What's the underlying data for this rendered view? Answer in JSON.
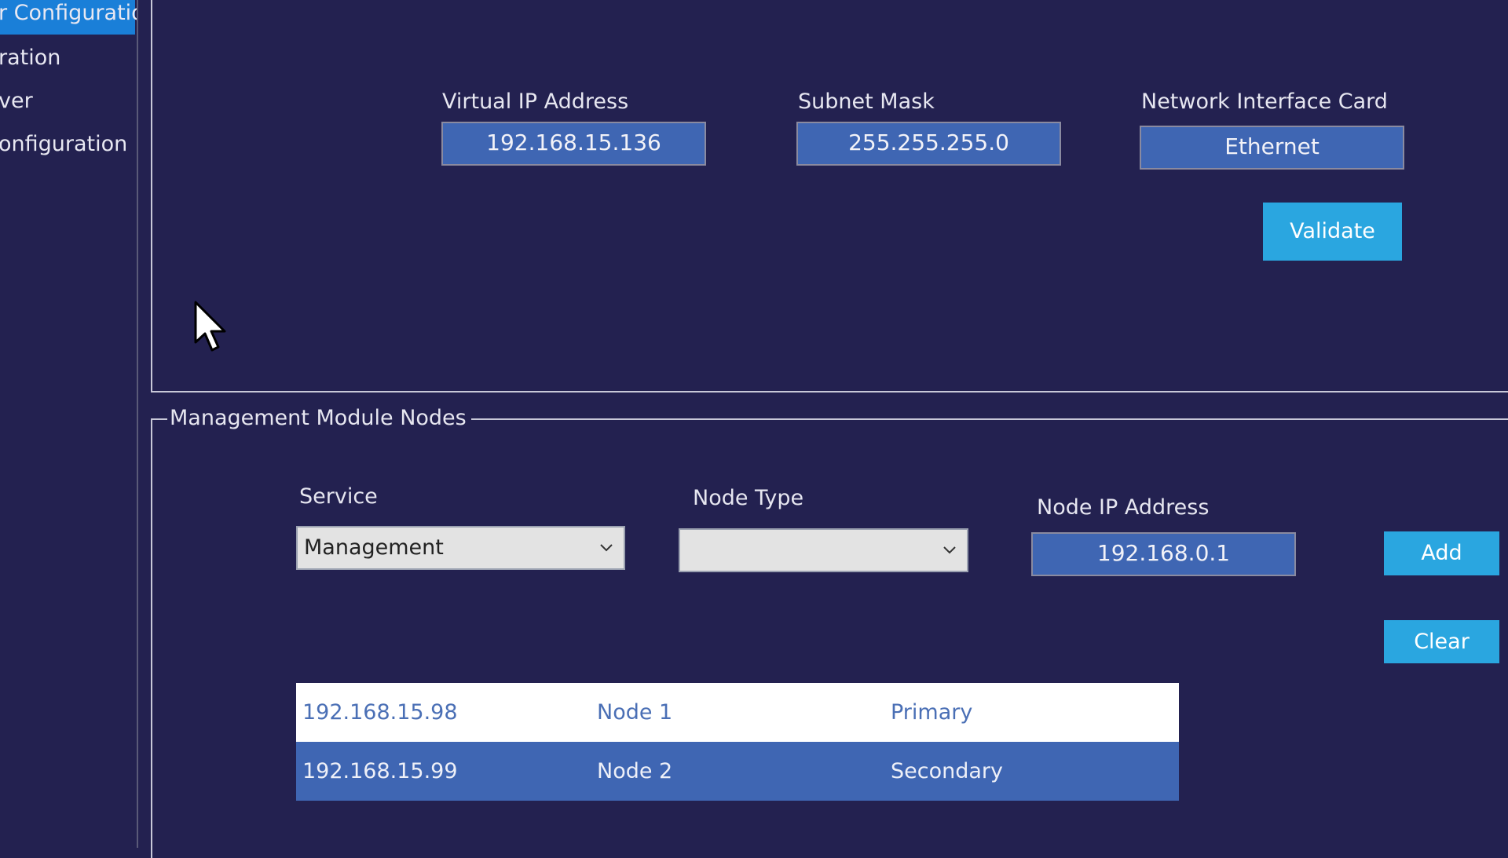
{
  "sidebar": {
    "items": [
      {
        "label": "r Configuratio",
        "active": true
      },
      {
        "label": "ration",
        "active": false
      },
      {
        "label": "ver",
        "active": false
      },
      {
        "label": "onfiguration",
        "active": false
      }
    ]
  },
  "vip_section": {
    "virtual_ip_label": "Virtual IP Address",
    "virtual_ip_value": "192.168.15.136",
    "subnet_label": "Subnet Mask",
    "subnet_value": "255.255.255.0",
    "nic_label": "Network Interface Card",
    "nic_value": "Ethernet",
    "validate_label": "Validate"
  },
  "nodes_section": {
    "title": "Management Module Nodes",
    "service_label": "Service",
    "service_value": "Management",
    "node_type_label": "Node Type",
    "node_type_value": "",
    "node_ip_label": "Node IP Address",
    "node_ip_value": "192.168.0.1",
    "add_label": "Add",
    "clear_label": "Clear",
    "rows": [
      {
        "ip": "192.168.15.98",
        "name": "Node 1",
        "role": "Primary"
      },
      {
        "ip": "192.168.15.99",
        "name": "Node 2",
        "role": "Secondary"
      }
    ]
  },
  "colors": {
    "background": "#232150",
    "field": "#3f66b3",
    "button": "#2aa6e0",
    "active_nav": "#1a7fd8"
  },
  "icons": [
    "chevron-down-icon",
    "mouse-cursor-icon"
  ]
}
